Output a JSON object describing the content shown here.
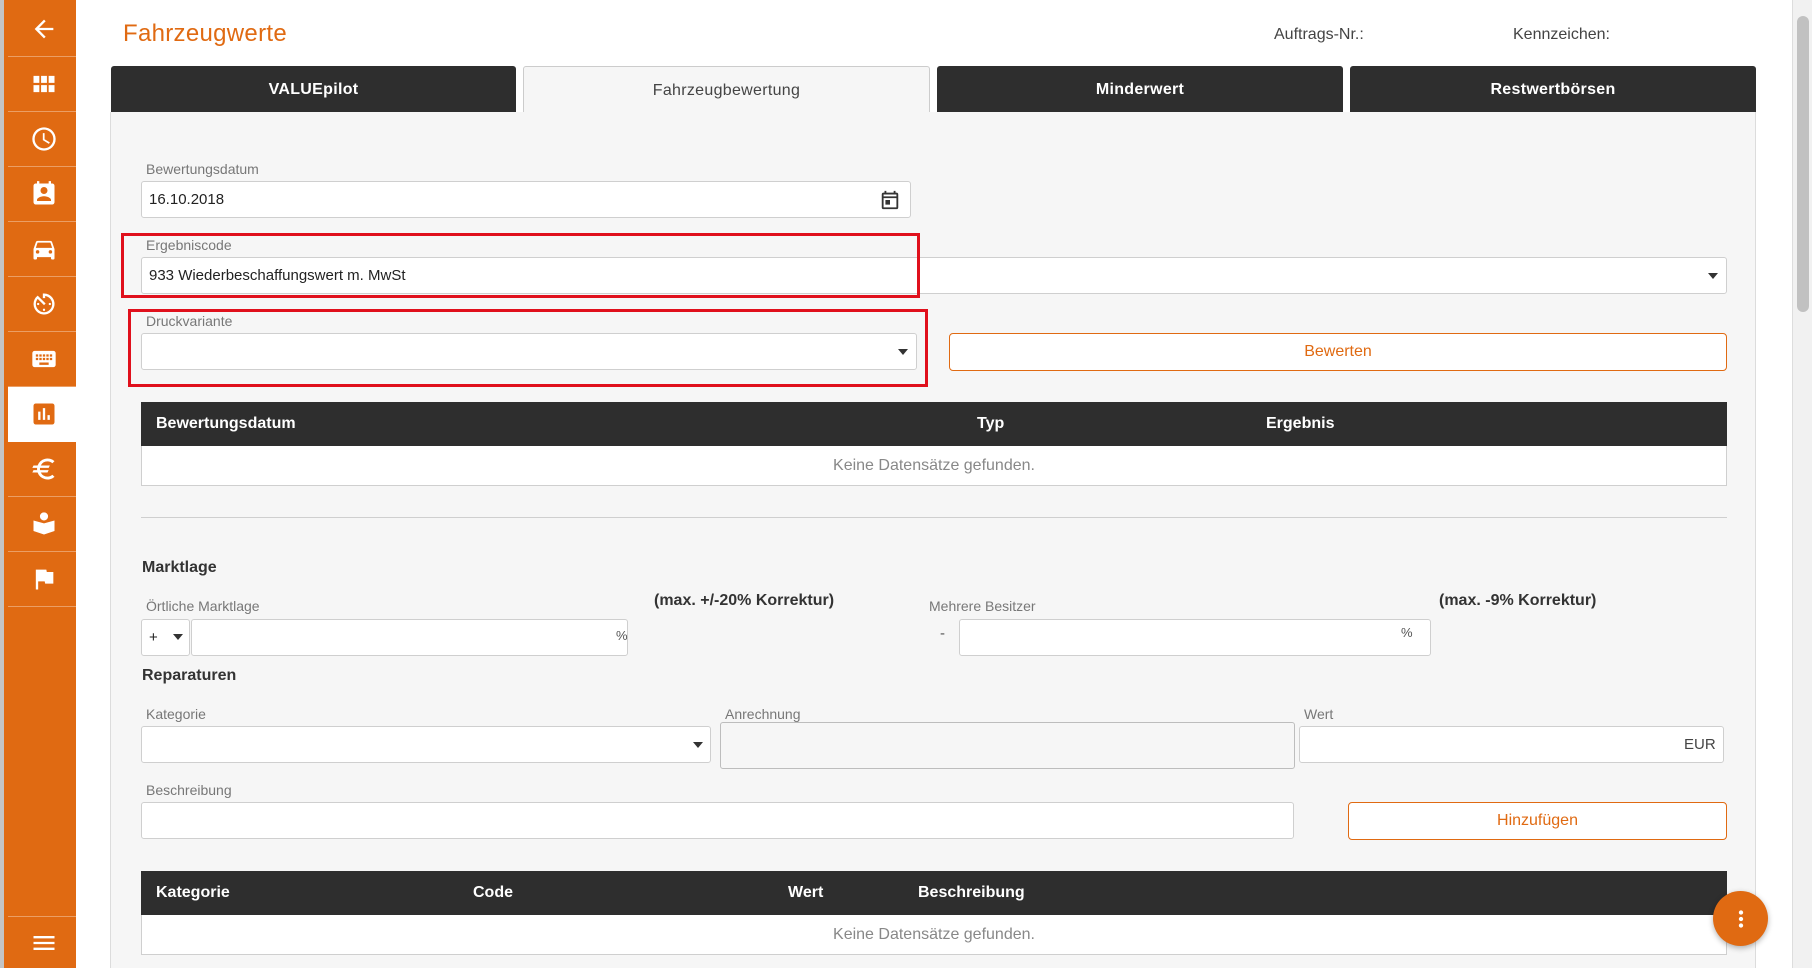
{
  "header": {
    "title": "Fahrzeugwerte",
    "auftrags_label": "Auftrags-Nr.:",
    "kennzeichen_label": "Kennzeichen:"
  },
  "sidebar": {
    "items": [
      {
        "icon": "back-arrow-icon"
      },
      {
        "icon": "dashboard-grid-icon"
      },
      {
        "icon": "clock-icon"
      },
      {
        "icon": "contact-card-icon"
      },
      {
        "icon": "car-icon"
      },
      {
        "icon": "timer-icon"
      },
      {
        "icon": "keyboard-icon"
      },
      {
        "icon": "bar-chart-icon",
        "active": true
      },
      {
        "icon": "euro-icon"
      },
      {
        "icon": "reading-person-icon"
      },
      {
        "icon": "flag-icon"
      }
    ],
    "bottom_icon": "menu-icon"
  },
  "tabs": [
    {
      "label": "VALUEpilot"
    },
    {
      "label": "Fahrzeugbewertung",
      "active": true
    },
    {
      "label": "Minderwert"
    },
    {
      "label": "Restwertbörsen"
    }
  ],
  "bewertung": {
    "datum_label": "Bewertungsdatum",
    "datum_value": "16.10.2018",
    "ergebniscode_label": "Ergebniscode",
    "ergebniscode_value": "933 Wiederbeschaffungswert m. MwSt",
    "druckvariante_label": "Druckvariante",
    "druckvariante_value": "",
    "bewerten_button": "Bewerten"
  },
  "results_table": {
    "columns": [
      "Bewertungsdatum",
      "Typ",
      "Ergebnis"
    ],
    "empty_text": "Keine Datensätze gefunden."
  },
  "marktlage": {
    "section_title": "Marktlage",
    "oertliche_label": "Örtliche Marktlage",
    "sign_value": "+",
    "oertliche_value": "",
    "percent_unit": "%",
    "oertliche_note": "(max. +/-20% Korrektur)",
    "besitzer_label": "Mehrere Besitzer",
    "besitzer_sign": "-",
    "besitzer_value": "",
    "besitzer_note": "(max. -9% Korrektur)"
  },
  "reparaturen": {
    "section_title": "Reparaturen",
    "kategorie_label": "Kategorie",
    "kategorie_value": "",
    "anrechnung_label": "Anrechnung",
    "anrechnung_value": "",
    "wert_label": "Wert",
    "wert_value": "",
    "currency": "EUR",
    "beschreibung_label": "Beschreibung",
    "beschreibung_value": "",
    "hinzufuegen_button": "Hinzufügen"
  },
  "repairs_table": {
    "columns": [
      "Kategorie",
      "Code",
      "Wert",
      "Beschreibung"
    ],
    "empty_text": "Keine Datensätze gefunden."
  },
  "fab_icon": "more-vertical-icon",
  "colors": {
    "accent": "#e06a12",
    "dark": "#2e2e2e",
    "highlight": "#e0101c"
  }
}
